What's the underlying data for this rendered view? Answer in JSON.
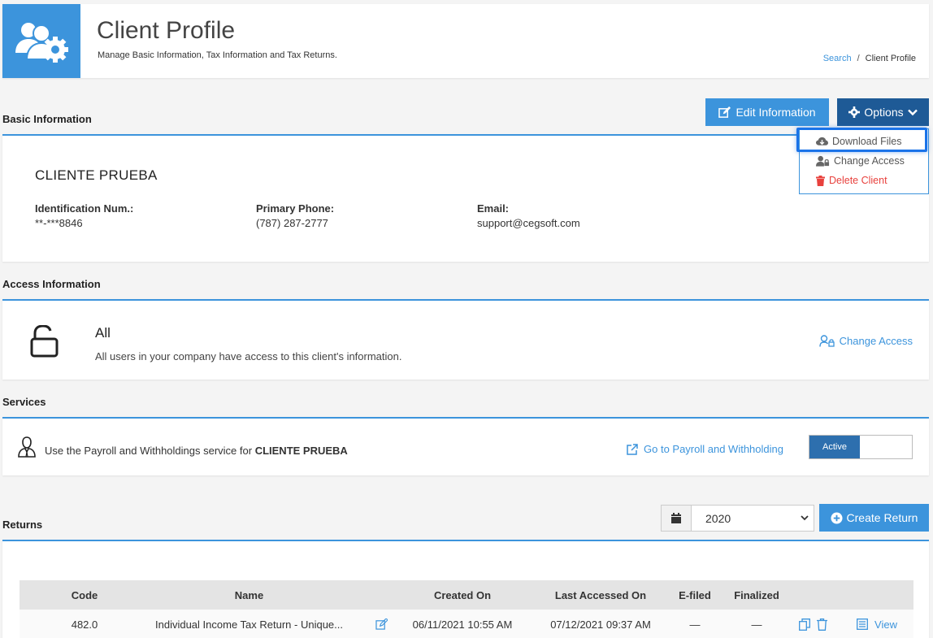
{
  "header": {
    "title": "Client Profile",
    "subtitle": "Manage Basic Information, Tax Information and Tax Returns.",
    "breadcrumb": {
      "link": "Search",
      "separator": "/",
      "current": "Client Profile"
    },
    "icon": "users-gear-icon"
  },
  "toolbar": {
    "edit_label": "Edit Information",
    "options_label": "Options"
  },
  "options_menu": {
    "items": [
      {
        "label": "Download Files",
        "icon": "cloud-download-icon"
      },
      {
        "label": "Change Access",
        "icon": "user-lock-icon"
      },
      {
        "label": "Delete Client",
        "icon": "trash-icon",
        "color": "#e8413d"
      }
    ]
  },
  "basic_info": {
    "section_title": "Basic Information",
    "client_name": "CLIENTE PRUEBA",
    "fields": [
      {
        "label": "Identification Num.:",
        "value": "**-***8846"
      },
      {
        "label": "Primary Phone:",
        "value": "(787) 287-2777"
      },
      {
        "label": "Email:",
        "value": "support@cegsoft.com"
      }
    ]
  },
  "access_info": {
    "section_title": "Access Information",
    "title": "All",
    "description": "All users in your company have access to this client's information.",
    "link": "Change Access"
  },
  "services": {
    "section_title": "Services",
    "text_prefix": "Use the Payroll and Withholdings service for",
    "client_name": "CLIENTE PRUEBA",
    "link": "Go to Payroll and Withholding",
    "toggle_label": "Active"
  },
  "returns": {
    "section_title": "Returns",
    "year": "2020",
    "create_label": "Create Return",
    "columns": [
      "Code",
      "Name",
      "Created On",
      "Last Accessed On",
      "E-filed",
      "Finalized"
    ],
    "rows": [
      {
        "code": "482.0",
        "name": "Individual Income Tax Return - Unique...",
        "created": "06/11/2021 10:55 AM",
        "accessed": "07/12/2021 09:37 AM",
        "efiled": "—",
        "finalized": "—",
        "view": "View"
      }
    ]
  },
  "colors": {
    "primary": "#3c94dc",
    "dark": "#1e5a96",
    "danger": "#e8413d"
  }
}
